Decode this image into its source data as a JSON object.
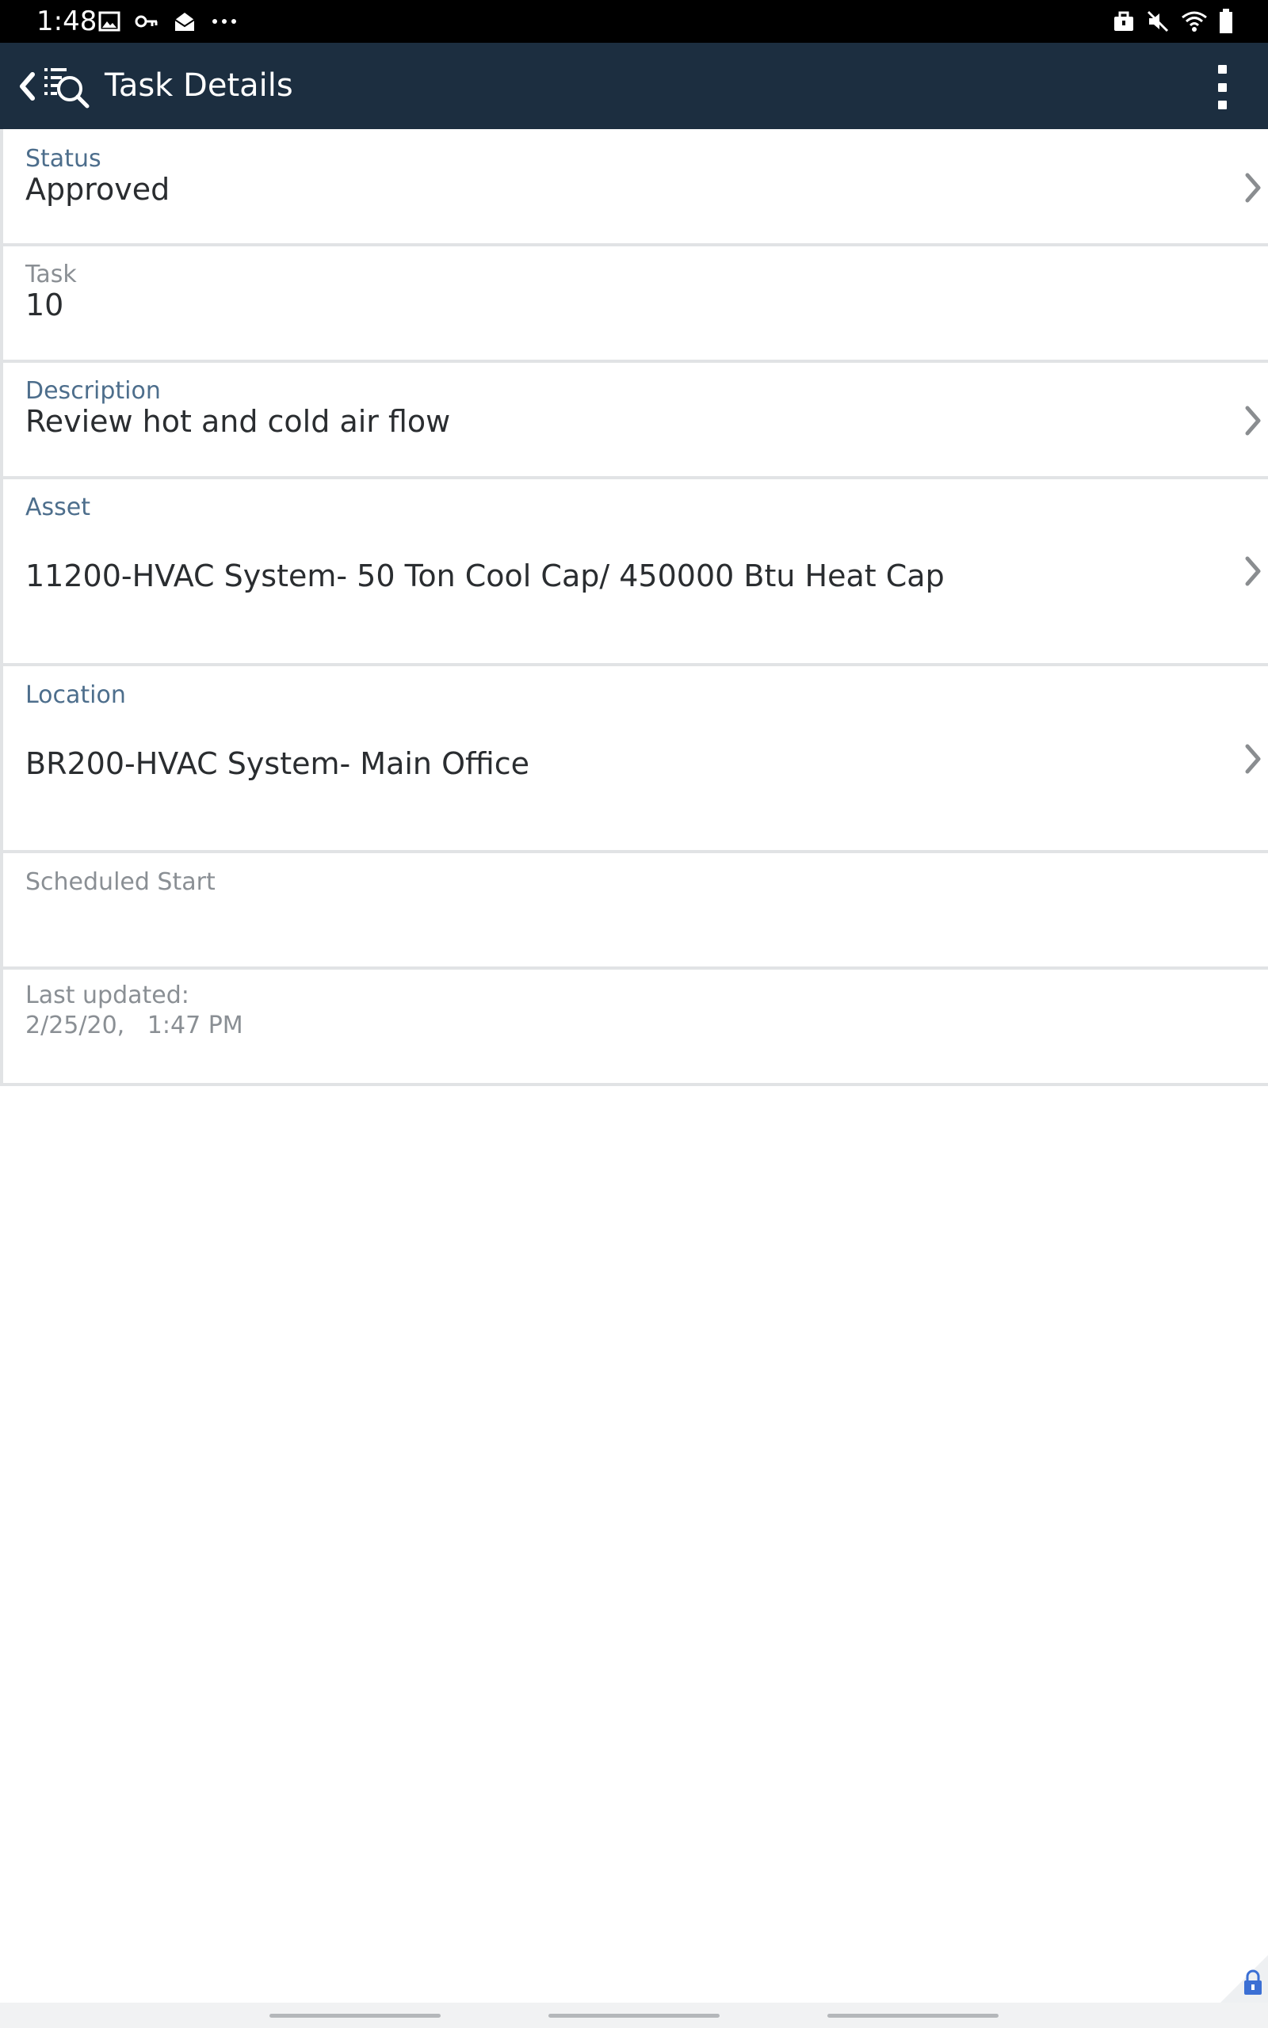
{
  "status_bar": {
    "time": "1:48",
    "left_icons": [
      "image-icon",
      "key-icon",
      "mail-open-icon",
      "more-dots-icon"
    ],
    "right_icons": [
      "briefcase-icon",
      "mute-icon",
      "wifi-icon",
      "battery-icon"
    ]
  },
  "app_bar": {
    "title": "Task Details",
    "background_color": "#1c2e40"
  },
  "fields": [
    {
      "label": "Status",
      "value": "Approved",
      "navigable": true
    },
    {
      "label": "Task",
      "value": "10",
      "navigable": false
    },
    {
      "label": "Description",
      "value": "Review hot and cold air flow",
      "navigable": true
    },
    {
      "label": "Asset",
      "value": "11200-HVAC System- 50 Ton Cool Cap/ 450000 Btu Heat Cap",
      "navigable": true
    },
    {
      "label": "Location",
      "value": "BR200-HVAC System- Main Office",
      "navigable": true
    },
    {
      "label": "Scheduled Start",
      "value": "",
      "navigable": false
    }
  ],
  "last_updated": {
    "label": "Last updated:",
    "value": "2/25/20,   1:47 PM"
  },
  "colors": {
    "label_blue": "#4d6e8c",
    "value_text": "#2a2d30",
    "muted_text": "#8a8f94",
    "divider": "#e1e3e5"
  }
}
